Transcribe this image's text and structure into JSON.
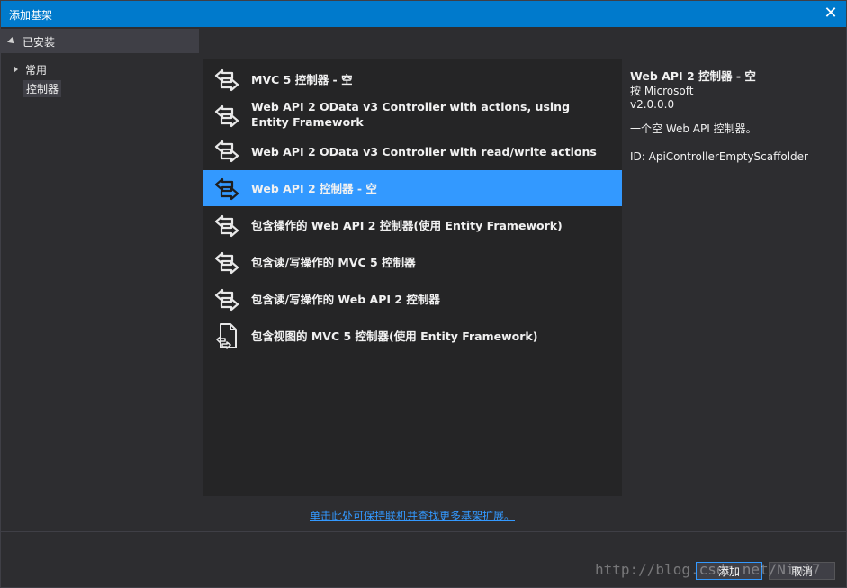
{
  "window": {
    "title": "添加基架",
    "close_glyph": "✕"
  },
  "tree": {
    "header": "已安装",
    "items": [
      {
        "label": "常用"
      },
      {
        "label": "控制器"
      }
    ]
  },
  "list": {
    "items": [
      {
        "label": "MVC 5 控制器 - 空",
        "icon": "controller-icon"
      },
      {
        "label": "Web API 2 OData v3 Controller with actions, using Entity Framework",
        "icon": "controller-icon"
      },
      {
        "label": "Web API 2 OData v3 Controller with read/write actions",
        "icon": "controller-icon"
      },
      {
        "label": "Web API 2 控制器 - 空",
        "icon": "controller-icon",
        "selected": true
      },
      {
        "label": "包含操作的 Web API 2 控制器(使用 Entity Framework)",
        "icon": "controller-icon"
      },
      {
        "label": "包含读/写操作的 MVC 5 控制器",
        "icon": "controller-icon"
      },
      {
        "label": "包含读/写操作的 Web API 2 控制器",
        "icon": "controller-icon"
      },
      {
        "label": "包含视图的 MVC 5 控制器(使用 Entity Framework)",
        "icon": "view-page-icon"
      }
    ]
  },
  "details": {
    "title": "Web API 2 控制器 - 空",
    "author": "按 Microsoft",
    "version": "v2.0.0.0",
    "description": "一个空 Web API 控制器。",
    "id": "ID: ApiControllerEmptyScaffolder"
  },
  "online_link": "单击此处可保持联机并查找更多基架扩展。",
  "buttons": {
    "add": "添加",
    "cancel": "取消"
  },
  "watermark": "http://blog.csdn.net/Nimi7"
}
